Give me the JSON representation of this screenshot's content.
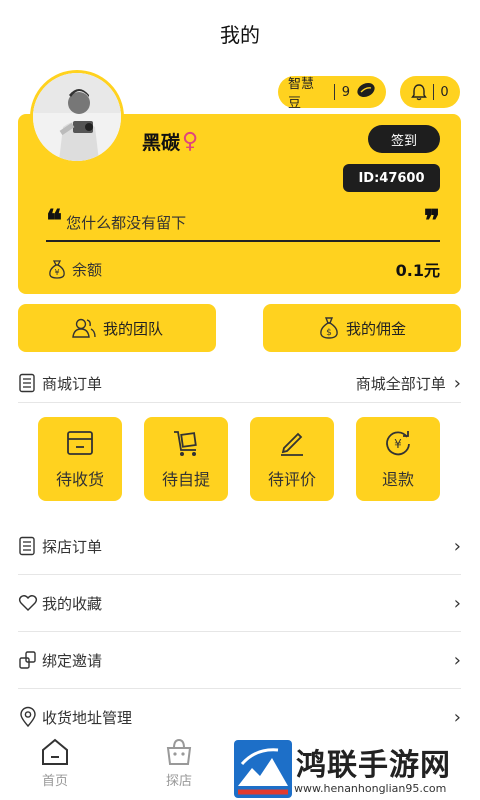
{
  "header": {
    "title": "我的"
  },
  "points": {
    "label": "智慧豆",
    "count": "9"
  },
  "notifications": {
    "count": "0"
  },
  "profile": {
    "nickname": "黑碳",
    "gender_symbol": "♀",
    "checkin_label": "签到",
    "id_label": "ID:47600",
    "quote_open": "❝",
    "quote_close": "❞",
    "bio": "您什么都没有留下",
    "balance_label": "余额",
    "balance_value": "0.1元"
  },
  "quick_actions": [
    {
      "label": "我的团队",
      "icon": "team-icon"
    },
    {
      "label": "我的佣金",
      "icon": "money-bag-icon"
    }
  ],
  "mall_orders": {
    "title": "商城订单",
    "all_label": "商城全部订单",
    "tiles": [
      {
        "label": "待收货",
        "icon": "box-icon"
      },
      {
        "label": "待自提",
        "icon": "cart-icon"
      },
      {
        "label": "待评价",
        "icon": "pen-icon"
      },
      {
        "label": "退款",
        "icon": "refund-icon"
      }
    ]
  },
  "menu": [
    {
      "label": "探店订单",
      "icon": "order-list-icon"
    },
    {
      "label": "我的收藏",
      "icon": "heart-icon"
    },
    {
      "label": "绑定邀请",
      "icon": "link-icon"
    },
    {
      "label": "收货地址管理",
      "icon": "location-icon"
    }
  ],
  "tabbar": [
    {
      "label": "首页",
      "icon": "home-icon"
    },
    {
      "label": "探店",
      "icon": "shop-bag-icon"
    }
  ],
  "watermark": {
    "text": "鸿联手游网",
    "url": "www.henanhonglian95.com"
  },
  "colors": {
    "accent": "#FFD21F",
    "dark": "#1e1e1e",
    "gender": "#e0457b"
  }
}
